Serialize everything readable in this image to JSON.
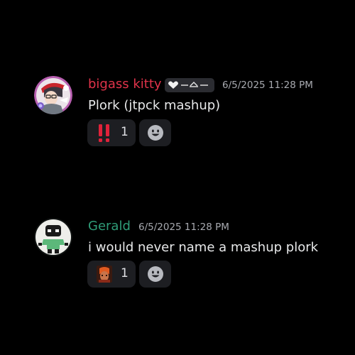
{
  "messages": [
    {
      "username": "bigass kitty",
      "username_color": "#e0334a",
      "timestamp": "6/5/2025 11:28 PM",
      "content": "Plork (jtpck mashup)",
      "reaction": {
        "emoji": "double-exclamation-icon",
        "count": "1"
      },
      "avatar": "kitty-avatar",
      "badge": "heart-tag-icon"
    },
    {
      "username": "Gerald",
      "username_color": "#2f9c78",
      "timestamp": "6/5/2025 11:28 PM",
      "content": "i would never name a mashup plork",
      "reaction": {
        "emoji": "custom-face-emoji",
        "count": "1"
      },
      "avatar": "gerald-avatar"
    }
  ],
  "colors": {
    "background": "#000000",
    "reaction_bg": "#1d1e22",
    "timestamp": "#a8aab0",
    "text": "#e8e9ea"
  }
}
